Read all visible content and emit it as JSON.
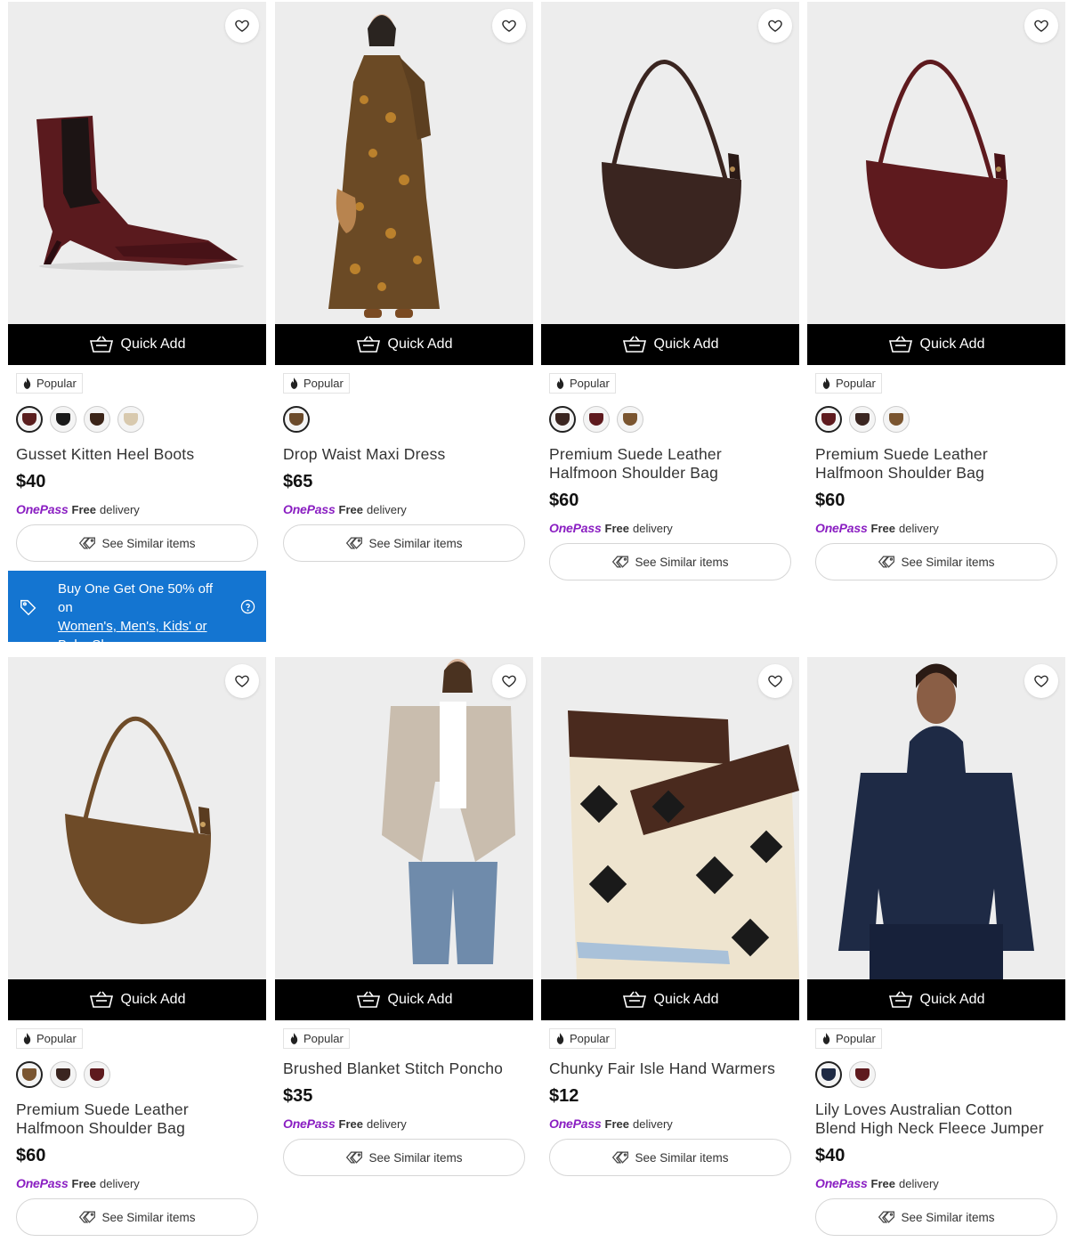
{
  "quick_add_label": "Quick Add",
  "badge_label": "Popular",
  "delivery": {
    "brand": "OnePass",
    "free": "Free",
    "rest": "delivery"
  },
  "similar_label": "See Similar items",
  "promo": {
    "line1": "Buy One Get One 50% off on",
    "link": "Women's, Men's, Kids' or Baby Shoes"
  },
  "products": [
    {
      "title": "Gusset Kitten Heel Boots",
      "price": "$40",
      "image": "burgundy-ankle-boot",
      "swatch_colors": [
        "#5a1e1e",
        "#1a1a1a",
        "#3b2418",
        "#d8c9ae"
      ]
    },
    {
      "title": "Drop Waist Maxi Dress",
      "price": "$65",
      "image": "floral-maxi-dress",
      "swatch_colors": [
        "#6b4a2a"
      ]
    },
    {
      "title": "Premium Suede Leather Halfmoon Shoulder Bag",
      "price": "$60",
      "image": "dark-brown-suede-bag",
      "swatch_colors": [
        "#3a2520",
        "#5e1a1e",
        "#7a5530"
      ]
    },
    {
      "title": "Premium Suede Leather Halfmoon Shoulder Bag",
      "price": "$60",
      "image": "burgundy-suede-bag",
      "swatch_colors": [
        "#5e1a1e",
        "#3a2520",
        "#7a5530"
      ]
    },
    {
      "title": "Premium Suede Leather Halfmoon Shoulder Bag",
      "price": "$60",
      "image": "tan-suede-bag",
      "swatch_colors": [
        "#7a5530",
        "#3a2520",
        "#5e1a1e"
      ]
    },
    {
      "title": "Brushed Blanket Stitch Poncho",
      "price": "$35",
      "image": "oatmeal-poncho",
      "swatch_colors": []
    },
    {
      "title": "Chunky Fair Isle Hand Warmers",
      "price": "$12",
      "image": "fair-isle-hand-warmers",
      "swatch_colors": []
    },
    {
      "title": "Lily Loves Australian Cotton Blend High Neck Fleece Jumper",
      "price": "$40",
      "image": "navy-fleece-jumper",
      "swatch_colors": [
        "#1e2a45",
        "#5e1a1e"
      ]
    }
  ]
}
